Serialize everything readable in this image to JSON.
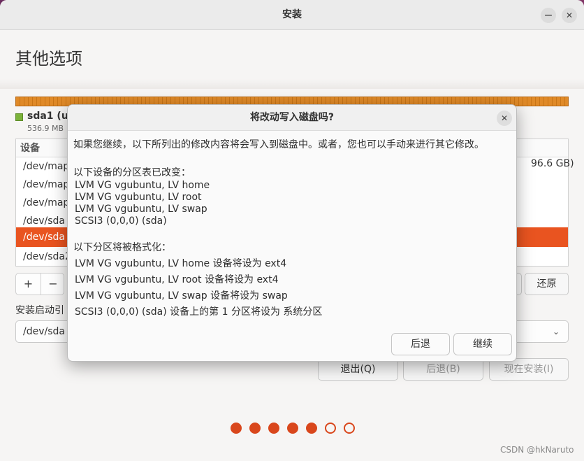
{
  "window": {
    "title": "安装",
    "minimize_icon": "minimize-icon",
    "close_icon": "close-icon"
  },
  "page": {
    "title": "其他选项"
  },
  "legend": {
    "name": "sda1 (ur",
    "size": "536.9 MB"
  },
  "table": {
    "header": "设备",
    "rows": [
      "/dev/map",
      "/dev/mapp",
      "/dev/map",
      "/dev/sda",
      "/dev/sda",
      "/dev/sda2"
    ],
    "selected_index": 4,
    "row1_right": "96.6 GB)"
  },
  "partition_buttons": {
    "add": "+",
    "remove": "−"
  },
  "revert_label": "还原",
  "boot": {
    "label": "安装启动引",
    "value": "/dev/sda"
  },
  "nav": {
    "quit": "退出(Q)",
    "back": "后退(B)",
    "install": "现在安装(I)"
  },
  "progress": {
    "total_steps": 7,
    "completed_steps": 5
  },
  "watermark": "CSDN @hkNaruto",
  "dialog": {
    "title": "将改动写入磁盘吗?",
    "intro": "如果您继续，以下所列出的修改内容将会写入到磁盘中。或者，您也可以手动来进行其它修改。",
    "tables_heading": "以下设备的分区表已改变：",
    "tables": [
      "LVM VG vgubuntu, LV home",
      "LVM VG vgubuntu, LV root",
      "LVM VG vgubuntu, LV swap",
      "SCSI3 (0,0,0) (sda)"
    ],
    "format_heading": "以下分区将被格式化：",
    "formats": [
      "LVM VG vgubuntu, LV home 设备将设为 ext4",
      "LVM VG vgubuntu, LV root 设备将设为 ext4",
      "LVM VG vgubuntu, LV swap 设备将设为 swap",
      "SCSI3 (0,0,0) (sda) 设备上的第 1 分区将设为 系统分区"
    ],
    "back_label": "后退",
    "continue_label": "继续"
  },
  "colors": {
    "accent": "#e95420",
    "partition_bar": "#e08a28",
    "legend_swatch": "#7bb33a"
  }
}
